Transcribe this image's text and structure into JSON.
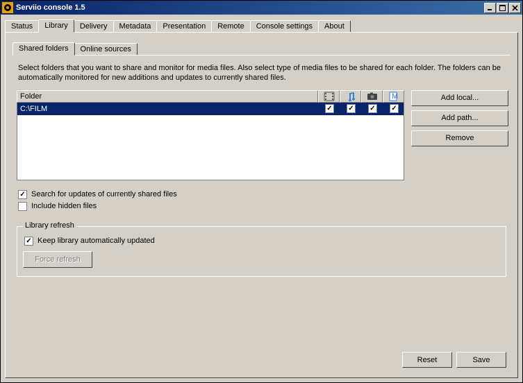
{
  "window": {
    "title": "Serviio console 1.5"
  },
  "tabs": {
    "main": [
      "Status",
      "Library",
      "Delivery",
      "Metadata",
      "Presentation",
      "Remote",
      "Console settings",
      "About"
    ],
    "main_active": 1,
    "sub": [
      "Shared folders",
      "Online sources"
    ],
    "sub_active": 0
  },
  "panel": {
    "instructions": "Select folders that you want to share and monitor for media files. Also select type of media files to be shared for each folder. The folders can be automatically monitored for new additions and updates to currently shared files.",
    "folder_header": "Folder",
    "col_icons": [
      "video",
      "audio",
      "image",
      "metadata"
    ],
    "rows": [
      {
        "path": "C:\\FILM",
        "checks": [
          true,
          true,
          true,
          true
        ]
      }
    ],
    "buttons": {
      "add_local": "Add local...",
      "add_path": "Add path...",
      "remove": "Remove"
    },
    "options": {
      "search_updates": {
        "label": "Search for updates of currently shared files",
        "checked": true
      },
      "include_hidden": {
        "label": "Include hidden files",
        "checked": false
      }
    },
    "refresh": {
      "legend": "Library refresh",
      "keep_updated": {
        "label": "Keep library automatically updated",
        "checked": true
      },
      "force_btn": "Force refresh"
    }
  },
  "footer": {
    "reset": "Reset",
    "save": "Save"
  }
}
